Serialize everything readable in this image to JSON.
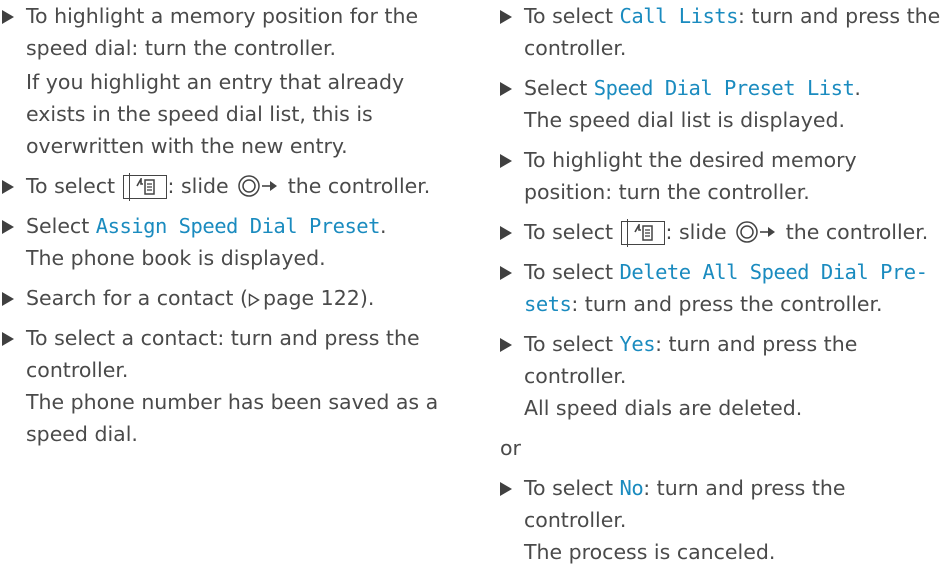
{
  "left": {
    "item1_text": "To highlight a memory position for the speed dial: turn the controller.",
    "item1_note": "If you highlight an entry that already exists in the speed dial list, this is overwritten with the new entry.",
    "item2_prefix": "To select",
    "item2_suffix": ": slide",
    "item2_end": "the controller.",
    "item3_prefix": "Select",
    "item3_menu": "Assign Speed Dial Preset",
    "item3_end": ".",
    "item3_result": "The phone book is displayed.",
    "item4_prefix": "Search for a contact (",
    "item4_page": "page 122",
    "item4_end": ").",
    "item5_text": "To select a contact: turn and press the controller.",
    "item5_result": "The phone number has been saved as a speed dial."
  },
  "right": {
    "item1_prefix": "To select",
    "item1_menu": "Call Lists",
    "item1_suffix": ": turn and press the controller.",
    "item2_prefix": "Select",
    "item2_menu": "Speed Dial Preset List",
    "item2_end": ".",
    "item2_result": "The speed dial list is displayed.",
    "item3_text": "To highlight the desired memory position: turn the controller.",
    "item4_prefix": "To select",
    "item4_suffix": ": slide",
    "item4_end": "the controller.",
    "item5_prefix": "To select",
    "item5_menu_a": "Delete All Speed Dial Pre-",
    "item5_menu_b": "sets",
    "item5_suffix": ": turn and press the controller.",
    "item6_prefix": "To select",
    "item6_menu": "Yes",
    "item6_suffix": ": turn and press the controller.",
    "item6_result": "All speed dials are deleted.",
    "or_text": "or",
    "item7_prefix": "To select",
    "item7_menu": "No",
    "item7_suffix": ": turn and press the controller.",
    "item7_result": "The process is canceled."
  },
  "icons": {
    "bullet": "right-triangle-bullet-icon",
    "phonebook_key": "phone-book-key-icon",
    "slide": "slide-right-controller-icon",
    "page_ref": "page-reference-triangle-icon"
  },
  "colors": {
    "text": "#4a4a4a",
    "menu_text": "#1a8bbf"
  }
}
